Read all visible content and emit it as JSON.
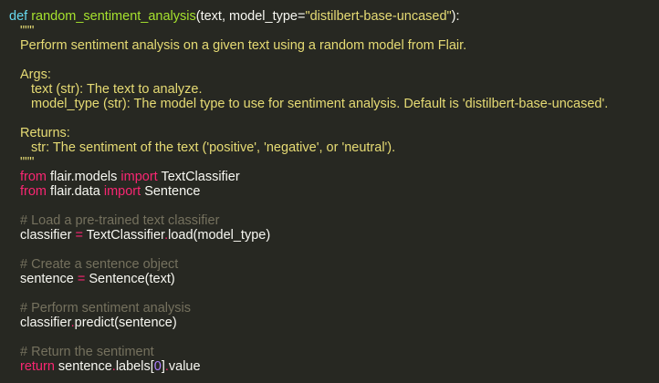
{
  "code": {
    "def_keyword": "def",
    "func_name": "random_sentiment_analysis",
    "params_open": "(text, model_type=",
    "default_value": "\"distilbert-base-uncased\"",
    "params_close": "):",
    "doc_open": "\"\"\"",
    "doc_summary": "Perform sentiment analysis on a given text using a random model from Flair.",
    "doc_args_header": "Args:",
    "doc_arg_text": "text (str): The text to analyze.",
    "doc_arg_model": "model_type (str): The model type to use for sentiment analysis. Default is 'distilbert-base-uncased'.",
    "doc_returns_header": "Returns:",
    "doc_returns_value": "str: The sentiment of the text ('positive', 'negative', or 'neutral').",
    "doc_close": "\"\"\"",
    "import1_from": "from",
    "import1_module": " flair.models ",
    "import1_import": "import",
    "import1_name": " TextClassifier",
    "import2_from": "from",
    "import2_module": " flair.data ",
    "import2_import": "import",
    "import2_name": " Sentence",
    "comment_load": "# Load a pre-trained text classifier",
    "classifier_var": "classifier ",
    "classifier_eq": "=",
    "classifier_rhs1": " TextClassifier",
    "classifier_dot": ".",
    "classifier_rhs2": "load(model_type)",
    "comment_create": "# Create a sentence object",
    "sentence_var": "sentence ",
    "sentence_eq": "=",
    "sentence_rhs": " Sentence(text)",
    "comment_perform": "# Perform sentiment analysis",
    "predict_obj": "classifier",
    "predict_dot": ".",
    "predict_call": "predict(sentence)",
    "comment_return": "# Return the sentiment",
    "return_keyword": "return",
    "return_obj": " sentence",
    "return_dot1": ".",
    "return_labels": "labels[",
    "return_index": "0",
    "return_close": "]",
    "return_dot2": ".",
    "return_value": "value"
  },
  "colors": {
    "background": "#272822",
    "keyword_blue": "#66d9ef",
    "keyword_red": "#f92672",
    "function_green": "#a6e22e",
    "string_yellow": "#e6db74",
    "comment_gray": "#75715e",
    "text": "#f8f8f2"
  }
}
